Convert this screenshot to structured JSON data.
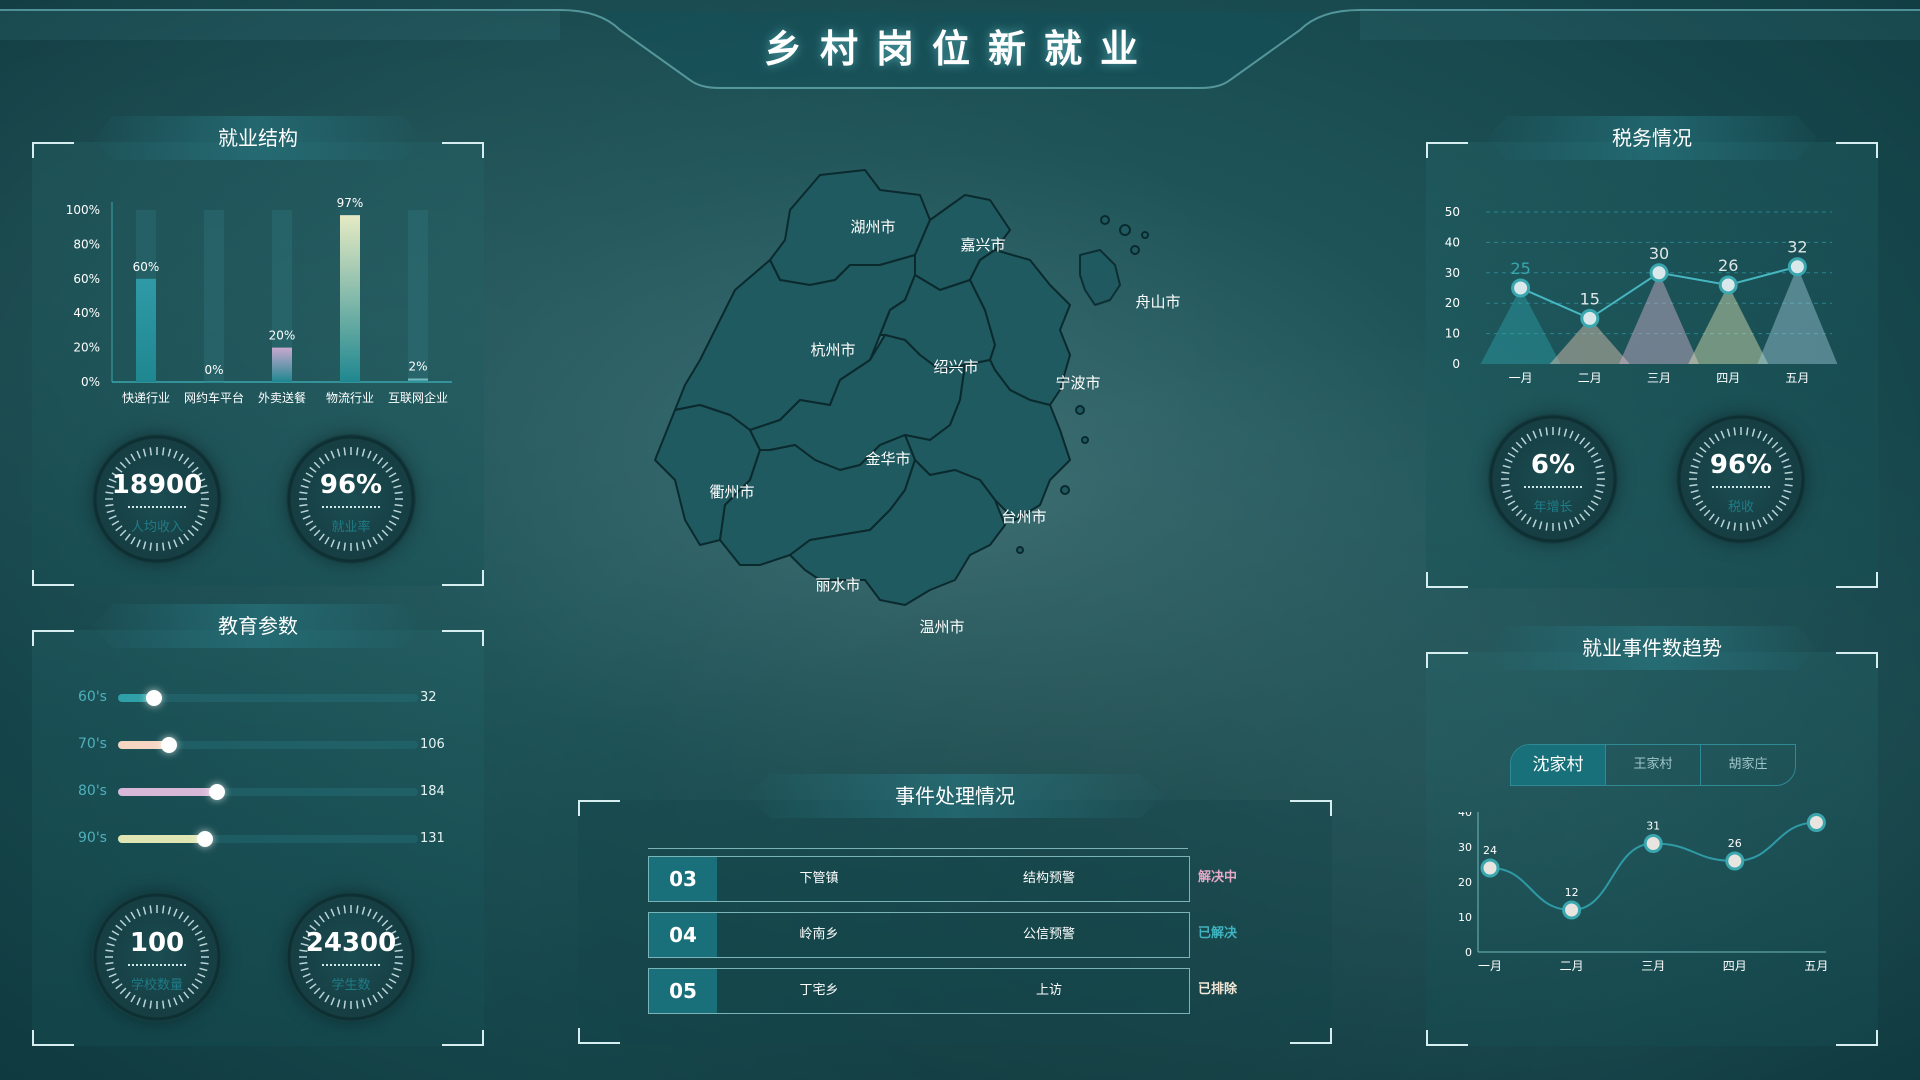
{
  "header": {
    "title": "乡村岗位新就业"
  },
  "employment": {
    "title": "就业结构",
    "y_ticks": [
      "100%",
      "80%",
      "60%",
      "40%",
      "20%",
      "0%"
    ],
    "gauges": [
      {
        "value": "18900",
        "label": "人均收入"
      },
      {
        "value": "96%",
        "label": "就业率"
      }
    ]
  },
  "education": {
    "title": "教育参数",
    "rows": [
      {
        "label": "60's",
        "value": "32",
        "level": 0.12,
        "color": "#2fa0a8"
      },
      {
        "label": "70's",
        "value": "106",
        "level": 0.17,
        "color": "#f6d6c3"
      },
      {
        "label": "80's",
        "value": "184",
        "level": 0.33,
        "color": "#d8b8d8"
      },
      {
        "label": "90's",
        "value": "131",
        "level": 0.29,
        "color": "#dfe6b4"
      }
    ],
    "gauges": [
      {
        "value": "100",
        "label": "学校数量"
      },
      {
        "value": "24300",
        "label": "学生数"
      }
    ]
  },
  "map": {
    "regions": [
      "湖州市",
      "嘉兴市",
      "舟山市",
      "杭州市",
      "绍兴市",
      "宁波市",
      "衢州市",
      "金华市",
      "台州市",
      "丽水市",
      "温州市"
    ]
  },
  "events": {
    "title": "事件处理情况",
    "rows": [
      {
        "num": "03",
        "place": "下管镇",
        "type": "结构预警",
        "status": "解决中",
        "color": "#e3a9c6"
      },
      {
        "num": "04",
        "place": "岭南乡",
        "type": "公信预警",
        "status": "已解决",
        "color": "#3fb3bf"
      },
      {
        "num": "05",
        "place": "丁宅乡",
        "type": "上访",
        "status": "已排除",
        "color": "#f3e7d6"
      }
    ]
  },
  "tax": {
    "title": "税务情况",
    "gauges": [
      {
        "value": "6%",
        "label": "年增长"
      },
      {
        "value": "96%",
        "label": "税收"
      }
    ]
  },
  "trend": {
    "title": "就业事件数趋势",
    "tabs": [
      "沈家村",
      "王家村",
      "胡家庄"
    ]
  },
  "chart_data": [
    {
      "type": "bar",
      "title": "就业结构",
      "categories": [
        "快递行业",
        "网约车平台",
        "外卖送餐",
        "物流行业",
        "互联网企业"
      ],
      "values": [
        60,
        0,
        20,
        97,
        2
      ],
      "value_labels": [
        "60%",
        "0%",
        "20%",
        "97%",
        "2%"
      ],
      "ylim": [
        0,
        100
      ],
      "colors": [
        "#2f9aa6",
        "#2f9aa6",
        "#c9a9cf",
        "#e6ebc4",
        "#8fc9cf"
      ]
    },
    {
      "type": "line",
      "title": "税务情况",
      "categories": [
        "一月",
        "二月",
        "三月",
        "四月",
        "五月"
      ],
      "values": [
        25,
        15,
        30,
        26,
        32
      ],
      "y_ticks": [
        "50",
        "40",
        "30",
        "20",
        "10",
        "0"
      ],
      "ylim": [
        0,
        50
      ],
      "grid": true,
      "triangle_colors": [
        "#2fa0a8",
        "#e9c9b6",
        "#d8b6d3",
        "#dfe6b4",
        "#9fc9da"
      ]
    },
    {
      "type": "line",
      "title": "就业事件数趋势",
      "categories": [
        "一月",
        "二月",
        "三月",
        "四月",
        "五月"
      ],
      "values": [
        24,
        12,
        31,
        26,
        37
      ],
      "y_ticks": [
        "40",
        "30",
        "20",
        "10",
        "0"
      ],
      "ylim": [
        0,
        40
      ]
    }
  ]
}
